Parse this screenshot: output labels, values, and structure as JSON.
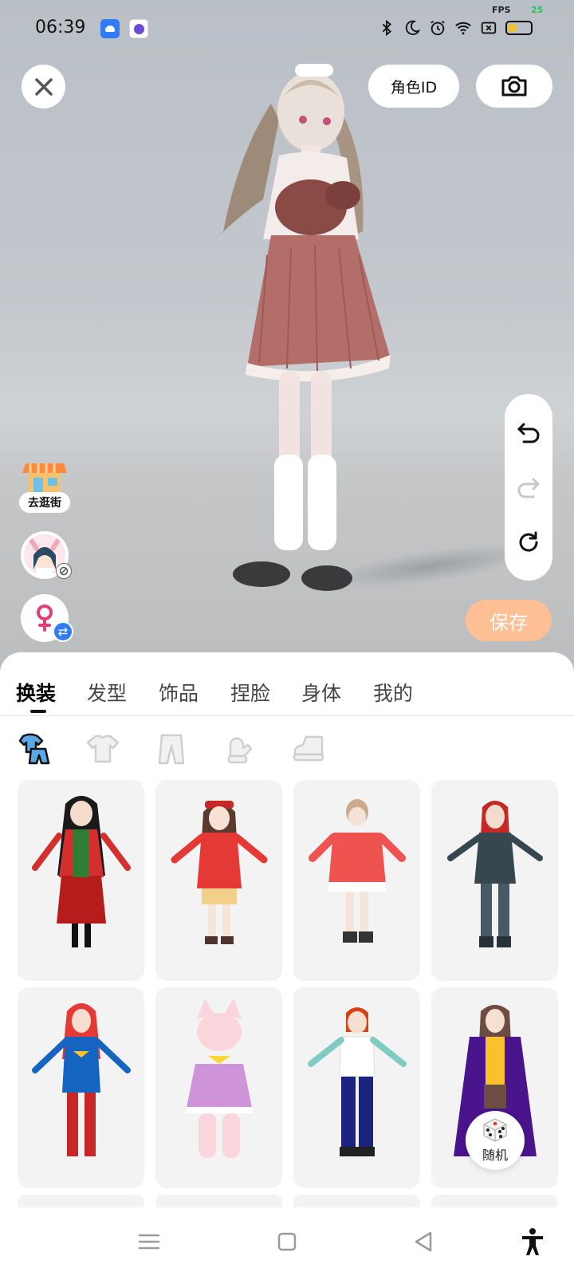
{
  "status_bar": {
    "time": "06:39",
    "fps_label": "FPS",
    "fps_value": "25",
    "icons": [
      "bluetooth-icon",
      "moon-icon",
      "alarm-icon",
      "wifi-icon",
      "sim-off-icon",
      "battery-icon"
    ]
  },
  "top_bar": {
    "role_id_label": "角色ID",
    "camera_icon": "camera-icon",
    "close_icon": "close-icon"
  },
  "left_shortcuts": {
    "shop_label": "去逛街"
  },
  "right_controls": {
    "undo_icon": "undo-icon",
    "redo_icon": "redo-icon",
    "reset_icon": "refresh-icon",
    "save_label": "保存"
  },
  "tabs": [
    {
      "label": "换装",
      "active": true
    },
    {
      "label": "发型",
      "active": false
    },
    {
      "label": "饰品",
      "active": false
    },
    {
      "label": "捏脸",
      "active": false
    },
    {
      "label": "身体",
      "active": false
    },
    {
      "label": "我的",
      "active": false
    }
  ],
  "subcategories": [
    "outfit-icon",
    "top-icon",
    "pants-icon",
    "gloves-icon",
    "shoes-icon"
  ],
  "random_label": "随机",
  "colors": {
    "save_button": "#ffbf95",
    "accent_blue": "#2f7cf6",
    "gender_female": "#e0407a"
  },
  "navbar": [
    "menu-icon",
    "home-icon",
    "back-icon",
    "accessibility-icon"
  ]
}
